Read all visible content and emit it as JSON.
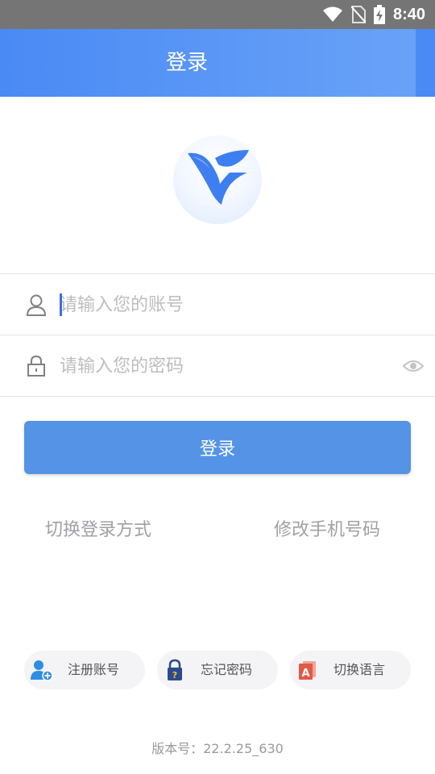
{
  "status_bar": {
    "time": "8:40",
    "icons": [
      "wifi-icon",
      "no-sim-icon",
      "battery-charging-icon"
    ]
  },
  "header": {
    "title": "登录"
  },
  "logo": {
    "icon": "bird-logo-icon",
    "color": "#3d7ff0"
  },
  "form": {
    "account": {
      "placeholder": "请输入您的账号",
      "value": "",
      "icon": "user-icon"
    },
    "password": {
      "placeholder": "请输入您的密码",
      "value": "",
      "icon": "lock-icon",
      "toggle_icon": "eye-icon"
    },
    "login_button": "登录"
  },
  "links": {
    "switch_login": "切换登录方式",
    "change_phone": "修改手机号码"
  },
  "chips": [
    {
      "label": "注册账号",
      "icon": "add-user-icon"
    },
    {
      "label": "忘记密码",
      "icon": "padlock-question-icon"
    },
    {
      "label": "切换语言",
      "icon": "language-icon"
    }
  ],
  "version": "版本号：22.2.25_630",
  "colors": {
    "accent": "#4a8af4",
    "button": "#5593e6",
    "status_bar": "#757575"
  }
}
